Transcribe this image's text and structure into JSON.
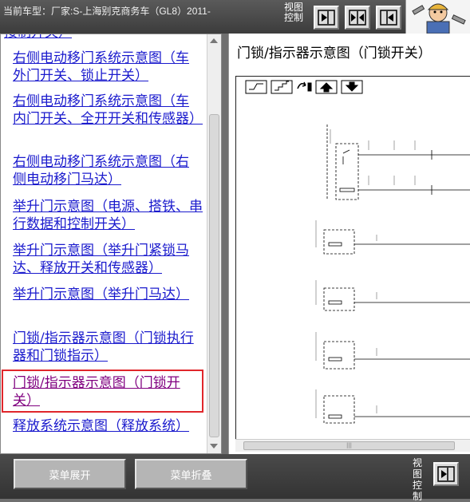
{
  "header": {
    "vehicle": "当前车型：厂家:S-上海别克商务车（GL8）2011-",
    "view_control": "视图控制"
  },
  "toc": {
    "partial_top": "接制开关）",
    "items": [
      "右侧电动移门系统示意图（车外门开关、锁止开关）",
      "右侧电动移门系统示意图（车内门开关、全开开关和传感器）",
      "右侧电动移门系统示意图（右侧电动移门马达）",
      "举升门示意图（电源、搭铁、串行数据和控制开关）",
      "举升门示意图（举升门紧锁马达、释放开关和传感器）",
      "举升门示意图（举升门马达）",
      "门锁/指示器示意图（门锁执行器和门锁指示）",
      "门锁/指示器示意图（门锁开关）",
      "释放系统示意图（释放系统）"
    ],
    "selected_index": 7
  },
  "document": {
    "title": "门锁/指示器示意图（门锁开关）",
    "scroll_thumb_grip": "|||"
  },
  "footer": {
    "expand_label": "菜单展开",
    "collapse_label": "菜单折叠",
    "view_control": "视图控制"
  },
  "colors": {
    "link": "#1a1acd",
    "visited": "#800080",
    "selection_border": "#e0262b"
  },
  "icons": {
    "nav_next": "arrow-right-boxed-icon",
    "nav_split": "split-panes-icon",
    "nav_prev": "arrow-left-boxed-icon",
    "logo": "mechanic-logo-icon"
  }
}
